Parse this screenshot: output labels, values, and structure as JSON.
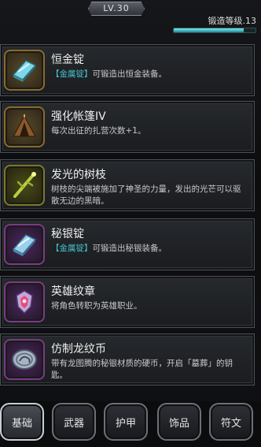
{
  "header": {
    "level_badge": "LV.30",
    "forge_level_label": "锻造等级.13",
    "forge_exp_fraction": 0.86
  },
  "items": [
    {
      "title": "恒金锭",
      "tag": "【金属锭】",
      "desc": "可锻造出恒金装备。",
      "icon": "blue-ingot-icon",
      "slot_color": "#8a6a2e"
    },
    {
      "title": "强化帐篷IV",
      "tag": "",
      "desc": "每次出征的扎营次数+1。",
      "icon": "tent-icon",
      "slot_color": "#8a6a2e"
    },
    {
      "title": "发光的树枝",
      "tag": "",
      "desc": "树枝的尖端被施加了神圣的力量，发出的光芒可以驱散无边的黑暗。",
      "icon": "glowing-branch-icon",
      "slot_color": "#7a7a2a"
    },
    {
      "title": "秘银锭",
      "tag": "【金属锭】",
      "desc": "可锻造出秘银装备。",
      "icon": "mithril-ingot-icon",
      "slot_color": "#7a3a8a"
    },
    {
      "title": "英雄纹章",
      "tag": "",
      "desc": "将角色转职为英雄职业。",
      "icon": "hero-crest-icon",
      "slot_color": "#7a3a8a"
    },
    {
      "title": "仿制龙纹币",
      "tag": "",
      "desc": "带有龙图腾的秘银材质的硬币，开启「墓葬」的钥匙。",
      "icon": "dragon-coin-icon",
      "slot_color": "#7a3a8a"
    }
  ],
  "tabs": [
    {
      "label": "基础",
      "active": true
    },
    {
      "label": "武器",
      "active": false
    },
    {
      "label": "护甲",
      "active": false
    },
    {
      "label": "饰品",
      "active": false
    },
    {
      "label": "符文",
      "active": false
    }
  ]
}
